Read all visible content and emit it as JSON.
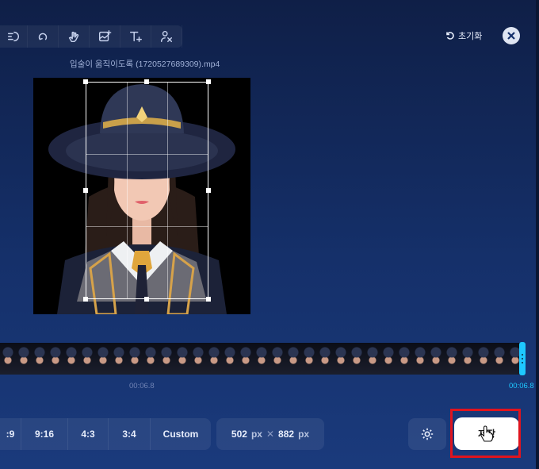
{
  "toolbar": {
    "tools": [
      {
        "name": "speed-icon"
      },
      {
        "name": "loop-icon"
      },
      {
        "name": "hand-gesture-icon"
      },
      {
        "name": "add-image-icon"
      },
      {
        "name": "add-text-icon"
      },
      {
        "name": "remove-person-icon"
      }
    ]
  },
  "header": {
    "reset_label": "초기화",
    "filename": "입술이 움직이도록 (1720527689309).mp4"
  },
  "timeline": {
    "current_time": "00:06.8",
    "end_time": "00:06.8"
  },
  "aspect_ratios": [
    ":9",
    "9:16",
    "4:3",
    "3:4",
    "Custom"
  ],
  "dimensions": {
    "width": "502",
    "height": "882",
    "unit": "px",
    "separator": "✕"
  },
  "save_button": {
    "label": "저장"
  },
  "colors": {
    "accent": "#1ec8ff",
    "highlight_box": "#e0141e",
    "background": "#15306a"
  }
}
